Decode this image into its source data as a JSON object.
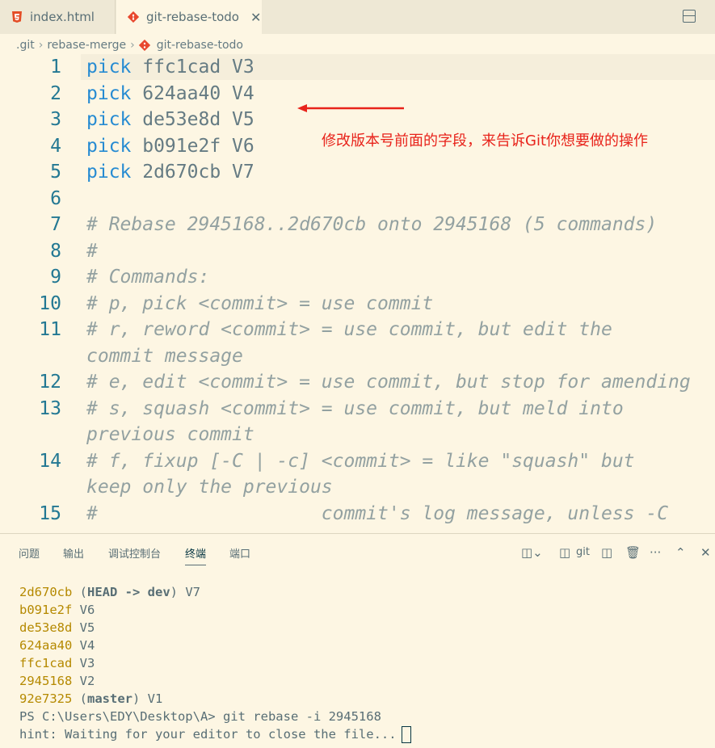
{
  "tabs": [
    {
      "label": "index.html"
    },
    {
      "label": "git-rebase-todo"
    }
  ],
  "tab_close": "✕",
  "breadcrumb": [
    ".git",
    "rebase-merge",
    "git-rebase-todo"
  ],
  "editor": {
    "lines": [
      {
        "n": "1",
        "kw": "pick",
        "rest": " ffc1cad V3"
      },
      {
        "n": "2",
        "kw": "pick",
        "rest": " 624aa40 V4"
      },
      {
        "n": "3",
        "kw": "pick",
        "rest": " de53e8d V5"
      },
      {
        "n": "4",
        "kw": "pick",
        "rest": " b091e2f V6"
      },
      {
        "n": "5",
        "kw": "pick",
        "rest": " 2d670cb V7"
      },
      {
        "n": "6",
        "kw": "",
        "rest": ""
      },
      {
        "n": "7",
        "kw": "",
        "rest": "# Rebase 2945168..2d670cb onto 2945168 (5 commands)"
      },
      {
        "n": "8",
        "kw": "",
        "rest": "#"
      },
      {
        "n": "9",
        "kw": "",
        "rest": "# Commands:"
      },
      {
        "n": "10",
        "kw": "",
        "rest": "# p, pick <commit> = use commit"
      },
      {
        "n": "11",
        "kw": "",
        "rest": "# r, reword <commit> = use commit, but edit the"
      },
      {
        "n": "",
        "kw": "",
        "rest": "commit message"
      },
      {
        "n": "12",
        "kw": "",
        "rest": "# e, edit <commit> = use commit, but stop for amending"
      },
      {
        "n": "13",
        "kw": "",
        "rest": "# s, squash <commit> = use commit, but meld into"
      },
      {
        "n": "",
        "kw": "",
        "rest": "previous commit"
      },
      {
        "n": "14",
        "kw": "",
        "rest": "# f, fixup [-C | -c] <commit> = like \"squash\" but"
      },
      {
        "n": "",
        "kw": "",
        "rest": "keep only the previous"
      },
      {
        "n": "15",
        "kw": "",
        "rest": "#                    commit's log message, unless -C"
      }
    ]
  },
  "annotation": "修改版本号前面的字段，来告诉Git你想要做的操作",
  "panel": {
    "tabs": [
      "问题",
      "输出",
      "调试控制台",
      "终端",
      "端口"
    ],
    "active_tab": "终端",
    "terminal_name": "git"
  },
  "terminal": [
    {
      "hash": "2d670cb",
      "rest": " (HEAD -> dev) V7"
    },
    {
      "hash": "b091e2f",
      "rest": " V6"
    },
    {
      "hash": "de53e8d",
      "rest": " V5"
    },
    {
      "hash": "624aa40",
      "rest": " V4"
    },
    {
      "hash": "ffc1cad",
      "rest": " V3"
    },
    {
      "hash": "2945168",
      "rest": " V2"
    },
    {
      "hash": "92e7325",
      "rest": " (master) V1"
    }
  ],
  "prompt": "PS C:\\Users\\EDY\\Desktop\\A> git rebase -i 2945168",
  "hint": "hint: Waiting for your editor to close the file...",
  "colors": {
    "accent": "#268bd2",
    "annotation": "#e8231b",
    "hash": "#b58900"
  }
}
